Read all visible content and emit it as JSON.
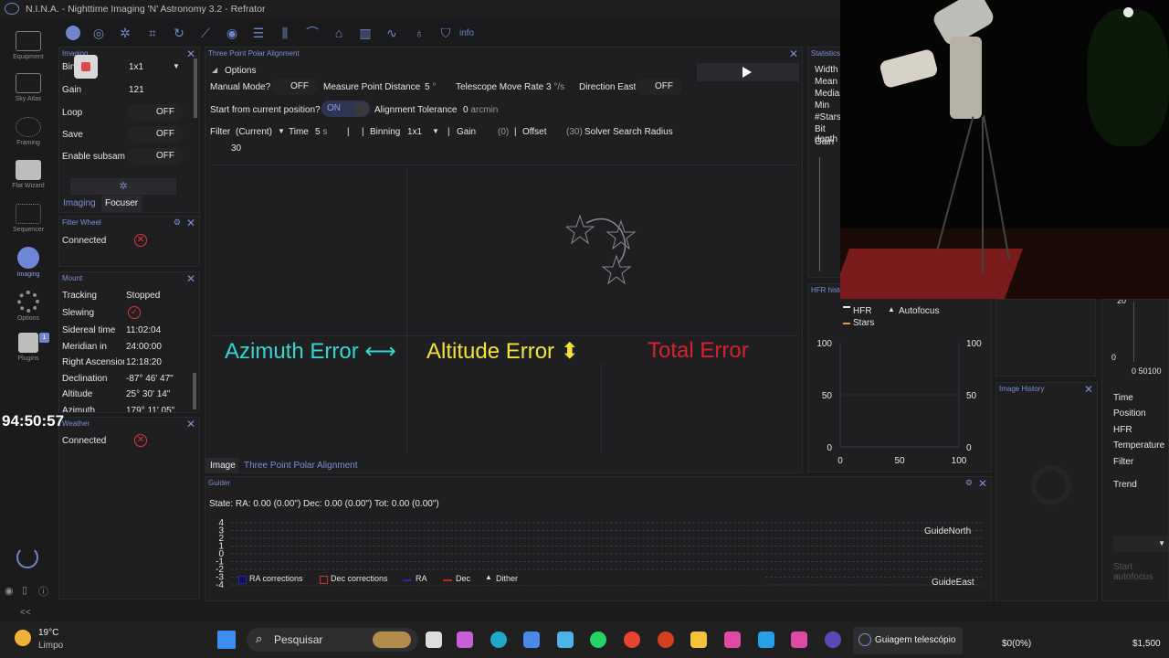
{
  "window": {
    "title": "N.I.N.A. - Nighttime Imaging 'N' Astronomy 3.2  -  Refrator"
  },
  "nav": [
    {
      "label": "Equipment",
      "icon": "camera-icon"
    },
    {
      "label": "Sky Atlas",
      "icon": "sky-atlas-icon"
    },
    {
      "label": "Framing",
      "icon": "framing-icon"
    },
    {
      "label": "Flat Wizard",
      "icon": "flat-wizard-icon"
    },
    {
      "label": "Sequencer",
      "icon": "sequencer-icon"
    },
    {
      "label": "Imaging",
      "icon": "imaging-icon"
    },
    {
      "label": "Options",
      "icon": "gear-icon"
    },
    {
      "label": "Plugins",
      "icon": "puzzle-icon",
      "badge": "1"
    }
  ],
  "toolbar": {
    "info_label": "info"
  },
  "clock": "94:50:57",
  "imaging": {
    "title": "Imaging",
    "bin_label": "Bin",
    "bin_value": "1x1",
    "gain_label": "Gain",
    "gain_value": "121",
    "loop_label": "Loop",
    "loop_value": "OFF",
    "save_label": "Save",
    "save_value": "OFF",
    "subsam_label": "Enable subsam",
    "subsam_value": "OFF",
    "tab1": "Imaging",
    "tab2": "Focuser"
  },
  "filter_wheel": {
    "title": "Filter Wheel",
    "connected_label": "Connected"
  },
  "mount": {
    "title": "Mount",
    "rows": [
      {
        "k": "Tracking",
        "v": "Stopped"
      },
      {
        "k": "Slewing",
        "v": ""
      },
      {
        "k": "Sidereal time",
        "v": "11:02:04"
      },
      {
        "k": "Meridian in",
        "v": "24:00:00"
      },
      {
        "k": "Right Ascension",
        "v": "12:18:20"
      },
      {
        "k": "Declination",
        "v": "-87° 46' 47\""
      },
      {
        "k": "Altitude",
        "v": "25° 30' 14\""
      },
      {
        "k": "Azimuth",
        "v": "179° 11' 05\""
      }
    ]
  },
  "weather": {
    "title": "Weather",
    "connected_label": "Connected"
  },
  "tppa": {
    "title": "Three Point Polar Alignment",
    "options_label": "Options",
    "manual_label": "Manual Mode?",
    "manual_value": "OFF",
    "mpd_label": "Measure Point Distance",
    "mpd_value": "5",
    "mpd_unit": "°",
    "tmr_label": "Telescope Move Rate",
    "tmr_value": "3",
    "tmr_unit": "°/s",
    "dir_label": "Direction East",
    "dir_value": "OFF",
    "start_label": "Start from current position?",
    "start_value": "ON",
    "tol_label": "Alignment Tolerance",
    "tol_value": "0",
    "tol_unit": "arcmin",
    "filter_label": "Filter",
    "filter_value": "(Current)",
    "time_label": "Time",
    "time_value": "5",
    "time_unit": "s",
    "binning_label": "Binning",
    "binning_value": "1x1",
    "gain_label": "Gain",
    "gain_value": "(0)",
    "offset_label": "Offset",
    "offset_value": "(30)",
    "ssr_label": "Solver Search Radius",
    "ssr_value": "30",
    "az_label": "Azimuth Error ⟷",
    "alt_label": "Altitude Error ⬍",
    "total_label": "Total Error",
    "tab_image": "Image",
    "tab_tppa": "Three Point Polar Alignment",
    "colors": {
      "az": "#35d6d0",
      "alt": "#f2e23a",
      "total": "#d4232d"
    }
  },
  "statistics": {
    "title": "Statistics",
    "rows": [
      "Width",
      "Mean",
      "Median",
      "Min",
      "#Stars",
      "Bit depth",
      "Gain"
    ]
  },
  "hfr_history": {
    "title": "HFR history",
    "legend_hfr": "HFR",
    "legend_autofocus": "Autofocus",
    "legend_stars": "Stars"
  },
  "image_history": {
    "title": "Image History"
  },
  "guider": {
    "title": "Guider",
    "state": "State:  RA: 0.00 (0.00\")  Dec: 0.00 (0.00\")  Tot: 0.00 (0.00\")",
    "north": "GuideNorth",
    "east": "GuideEast",
    "legend": [
      "RA corrections",
      "Dec corrections",
      "RA",
      "Dec",
      "Dither"
    ]
  },
  "right_panel": {
    "rows": [
      "Time",
      "Position",
      "HFR",
      "Temperature",
      "Filter"
    ],
    "trend": "Trend",
    "start_btn": "Start autofocus"
  },
  "chart_data": [
    {
      "type": "line",
      "title": "HFR history",
      "x": [],
      "series": [],
      "xlim": [
        0,
        100
      ],
      "ylim": [
        0,
        100
      ],
      "xticks": [
        "0",
        "50",
        "100"
      ],
      "yticks": [
        "0",
        "50",
        "100"
      ],
      "yticks_right": [
        "0",
        "50",
        "100"
      ]
    },
    {
      "type": "line",
      "title": "Guider",
      "x": [],
      "series": [],
      "ylim": [
        -4,
        4
      ],
      "yticks": [
        "4",
        "3",
        "2",
        "1",
        "0",
        "-1",
        "-2",
        "-3",
        "-4"
      ]
    }
  ],
  "taskbar": {
    "weather_temp": "19°C",
    "weather_desc": "Limpo",
    "search_placeholder": "Pesquisar",
    "active_app": "Guiagem telescópio",
    "ticker1": "$0(0%)",
    "ticker2": "$1,500"
  }
}
